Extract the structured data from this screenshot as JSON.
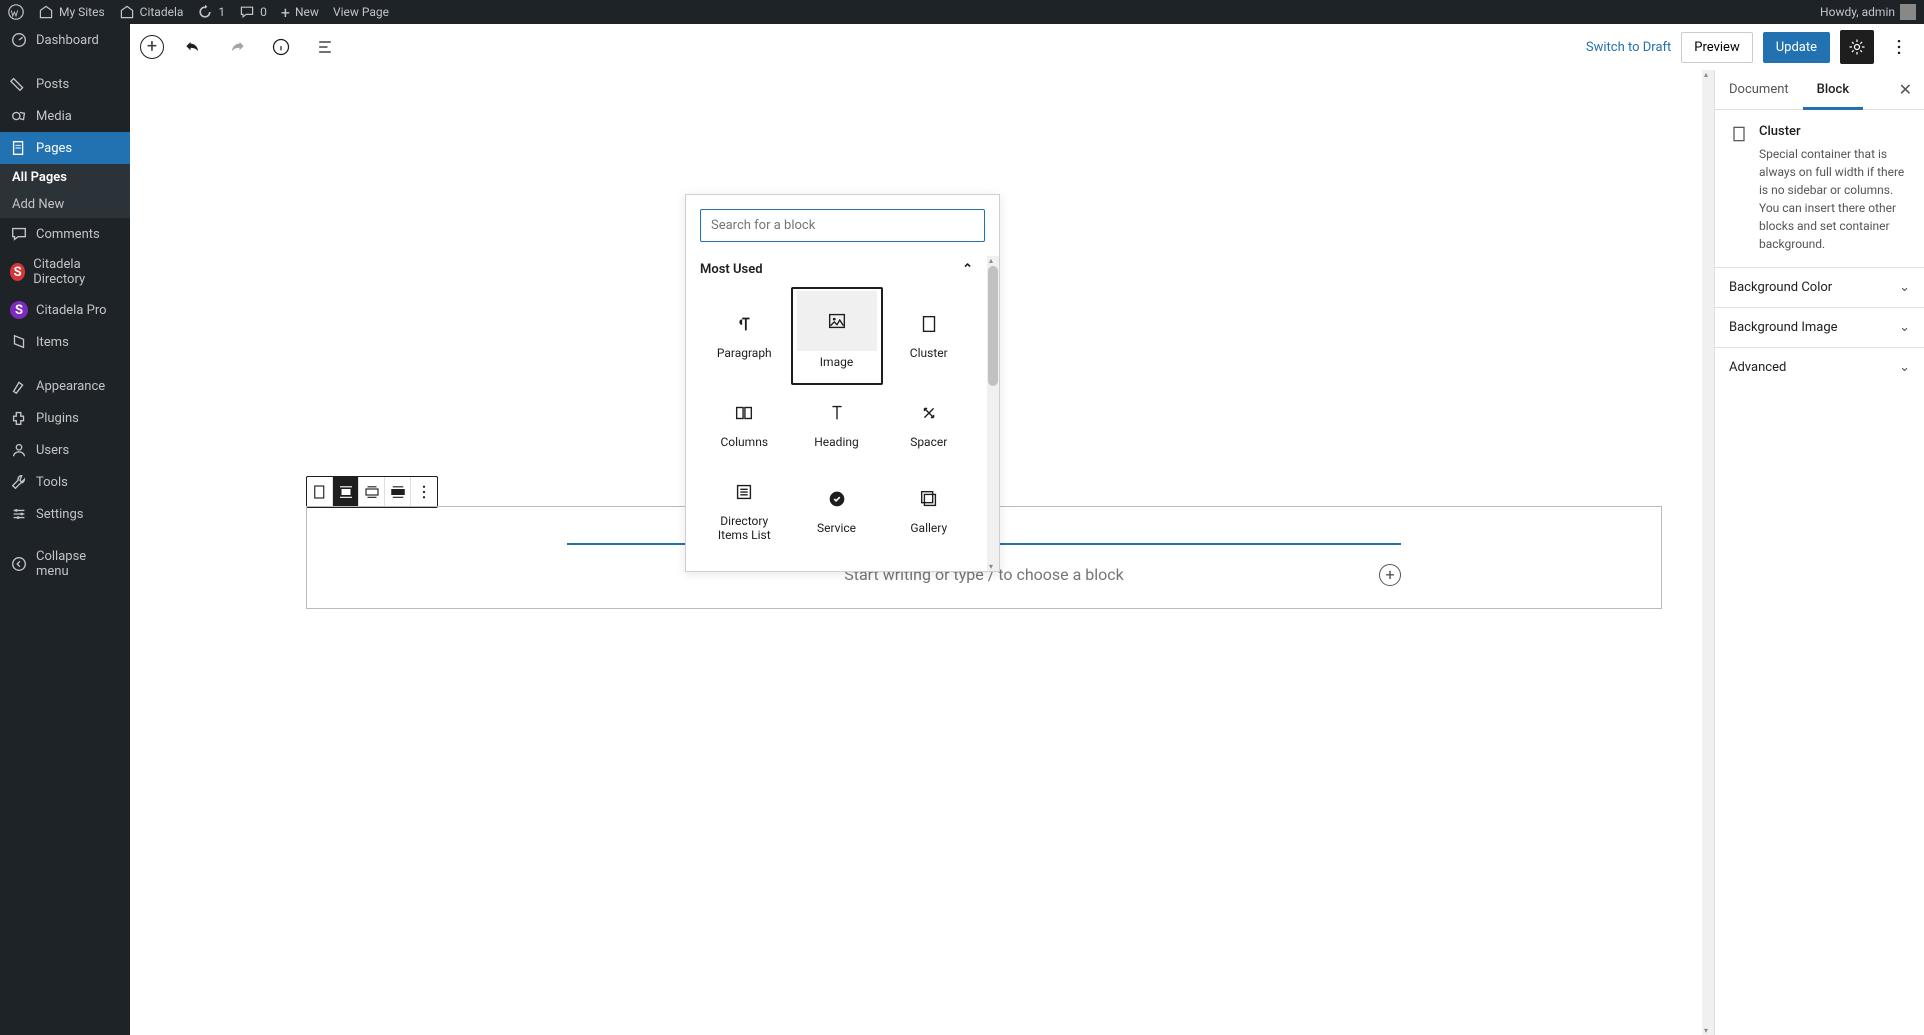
{
  "adminbar": {
    "my_sites": "My Sites",
    "site_name": "Citadela",
    "updates": "1",
    "comments": "0",
    "new": "New",
    "view_page": "View Page",
    "howdy": "Howdy, admin"
  },
  "sidebar": {
    "dashboard": "Dashboard",
    "posts": "Posts",
    "media": "Media",
    "pages": "Pages",
    "all_pages": "All Pages",
    "add_new": "Add New",
    "comments": "Comments",
    "citadela_directory": "Citadela Directory",
    "citadela_pro": "Citadela Pro",
    "items": "Items",
    "appearance": "Appearance",
    "plugins": "Plugins",
    "users": "Users",
    "tools": "Tools",
    "settings": "Settings",
    "collapse": "Collapse menu"
  },
  "editbar": {
    "switch_to_draft": "Switch to Draft",
    "preview": "Preview",
    "update": "Update"
  },
  "inserter": {
    "search_placeholder": "Search for a block",
    "section": "Most Used",
    "blocks": [
      {
        "label": "Paragraph"
      },
      {
        "label": "Image"
      },
      {
        "label": "Cluster"
      },
      {
        "label": "Columns"
      },
      {
        "label": "Heading"
      },
      {
        "label": "Spacer"
      },
      {
        "label": "Directory Items List"
      },
      {
        "label": "Service"
      },
      {
        "label": "Gallery"
      }
    ]
  },
  "canvas": {
    "placeholder": "Start writing or type / to choose a block"
  },
  "settings": {
    "tab_document": "Document",
    "tab_block": "Block",
    "block_name": "Cluster",
    "block_desc": "Special container that is always on full width if there is no sidebar or columns. You can insert there other blocks and set container background.",
    "panel_bg_color": "Background Color",
    "panel_bg_image": "Background Image",
    "panel_advanced": "Advanced"
  }
}
